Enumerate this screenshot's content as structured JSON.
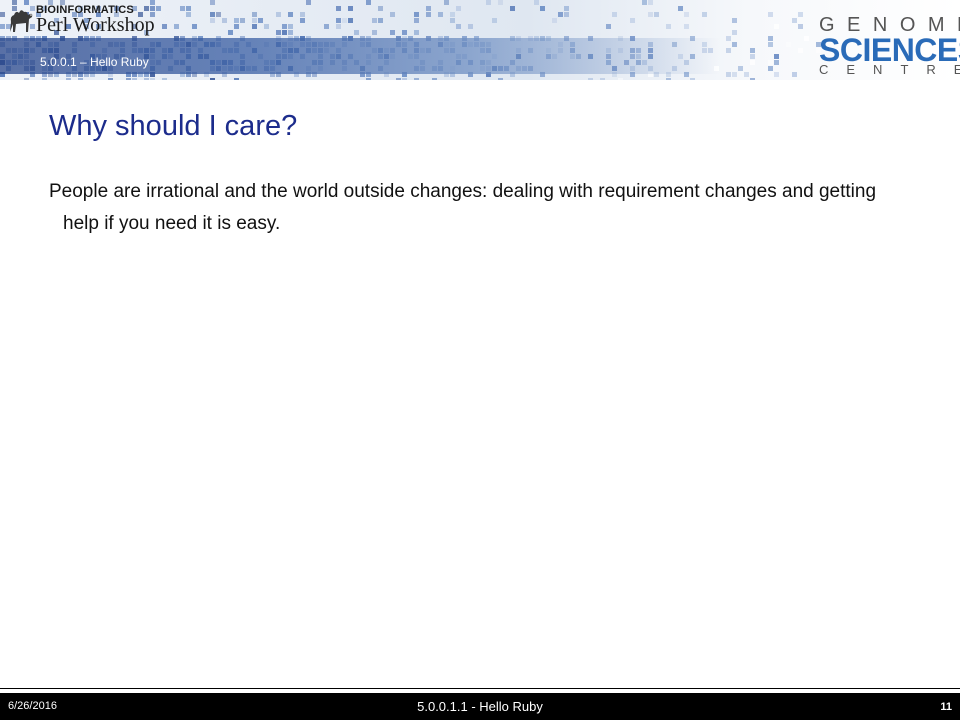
{
  "header": {
    "logo_left_line1": "BIOINFORMATICS",
    "logo_left_line2": "Perl Workshop",
    "subtitle": "5.0.0.1 – Hello Ruby",
    "logo_right": {
      "line1": "GENOME",
      "line2": "SCIENCES",
      "line3": "CENTRE"
    }
  },
  "slide": {
    "title": "Why should I care?",
    "body": "People are irrational and the world outside changes: dealing with requirement changes and getting help if you need it is easy."
  },
  "footer": {
    "date": "6/26/2016",
    "title": "5.0.0.1.1 - Hello Ruby",
    "page": "11"
  },
  "colors": {
    "title": "#1c2c8c",
    "sciences": "#2a6bb8",
    "band": "#27458a",
    "footer_bg": "#000000"
  }
}
